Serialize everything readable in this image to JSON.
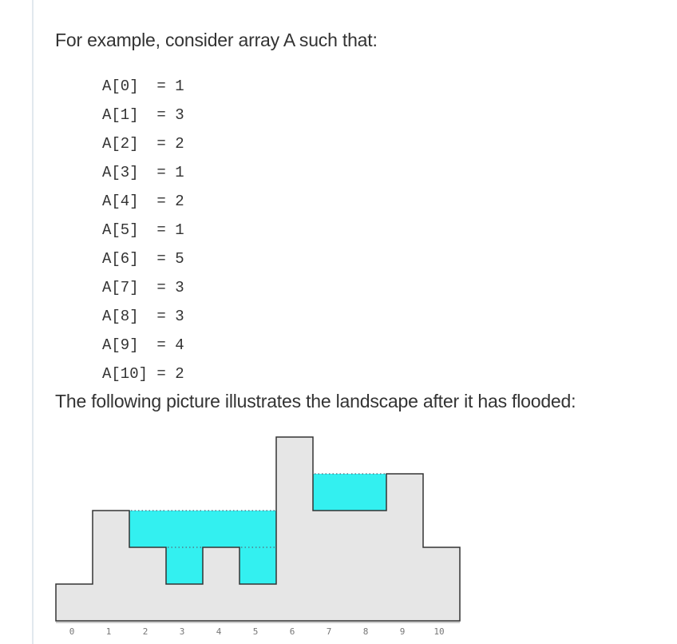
{
  "intro_text": "For example, consider array A such that:",
  "array": [
    {
      "label": "A[0]",
      "value": "1"
    },
    {
      "label": "A[1]",
      "value": "3"
    },
    {
      "label": "A[2]",
      "value": "2"
    },
    {
      "label": "A[3]",
      "value": "1"
    },
    {
      "label": "A[4]",
      "value": "2"
    },
    {
      "label": "A[5]",
      "value": "1"
    },
    {
      "label": "A[6]",
      "value": "5"
    },
    {
      "label": "A[7]",
      "value": "3"
    },
    {
      "label": "A[8]",
      "value": "3"
    },
    {
      "label": "A[9]",
      "value": "4"
    },
    {
      "label": "A[10]",
      "value": "2"
    }
  ],
  "caption_text": "The following picture illustrates the landscape after it has flooded:",
  "figure": {
    "heights": [
      1,
      3,
      2,
      1,
      2,
      1,
      5,
      3,
      3,
      4,
      2
    ],
    "water_levels": [
      1,
      3,
      3,
      3,
      3,
      3,
      5,
      4,
      4,
      4,
      2
    ],
    "axis_labels": [
      "0",
      "1",
      "2",
      "3",
      "4",
      "5",
      "6",
      "7",
      "8",
      "9",
      "10"
    ],
    "colors": {
      "ground": "#e6e6e6",
      "outline": "#333333",
      "water": "#33f0f0",
      "baseline": "#bbbbbb",
      "axis_text": "#777777"
    }
  }
}
